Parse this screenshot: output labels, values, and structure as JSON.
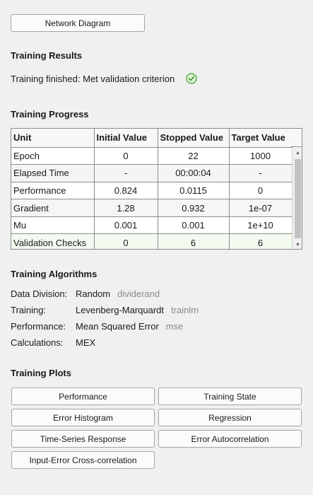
{
  "network_button": "Network Diagram",
  "results": {
    "heading": "Training Results",
    "status": "Training finished: Met validation criterion",
    "status_icon": "check-circle-icon",
    "status_color": "#3fa52f"
  },
  "progress": {
    "heading": "Training Progress",
    "columns": [
      "Unit",
      "Initial Value",
      "Stopped Value",
      "Target Value"
    ],
    "rows": [
      {
        "unit": "Epoch",
        "initial": "0",
        "stopped": "22",
        "target": "1000"
      },
      {
        "unit": "Elapsed Time",
        "initial": "-",
        "stopped": "00:00:04",
        "target": "-"
      },
      {
        "unit": "Performance",
        "initial": "0.824",
        "stopped": "0.0115",
        "target": "0"
      },
      {
        "unit": "Gradient",
        "initial": "1.28",
        "stopped": "0.932",
        "target": "1e-07"
      },
      {
        "unit": "Mu",
        "initial": "0.001",
        "stopped": "0.001",
        "target": "1e+10"
      },
      {
        "unit": "Validation Checks",
        "initial": "0",
        "stopped": "6",
        "target": "6"
      }
    ]
  },
  "algorithms": {
    "heading": "Training Algorithms",
    "rows": [
      {
        "label": "Data Division:",
        "value": "Random",
        "code": "dividerand"
      },
      {
        "label": "Training:",
        "value": "Levenberg-Marquardt",
        "code": "trainlm"
      },
      {
        "label": "Performance:",
        "value": "Mean Squared Error",
        "code": "mse"
      },
      {
        "label": "Calculations:",
        "value": "MEX",
        "code": ""
      }
    ]
  },
  "plots": {
    "heading": "Training Plots",
    "buttons": [
      "Performance",
      "Training State",
      "Error Histogram",
      "Regression",
      "Time-Series Response",
      "Error Autocorrelation",
      "Input-Error Cross-correlation"
    ]
  }
}
